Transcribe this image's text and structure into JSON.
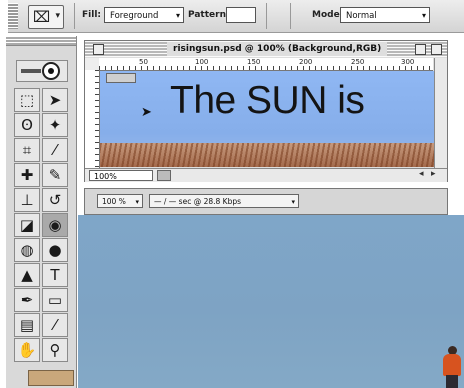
{
  "options_bar": {
    "tool_preset_glyph": "⌧",
    "fill_label": "Fill:",
    "fill_value": "Foreground",
    "pattern_label": "Pattern:",
    "mode_label": "Mode:",
    "mode_value": "Normal"
  },
  "toolbox": {
    "tools": [
      {
        "name": "marquee-tool-icon",
        "glyph": "⬚"
      },
      {
        "name": "move-tool-icon",
        "glyph": "➤"
      },
      {
        "name": "lasso-tool-icon",
        "glyph": "ʘ"
      },
      {
        "name": "magic-wand-tool-icon",
        "glyph": "✦"
      },
      {
        "name": "crop-tool-icon",
        "glyph": "⌗"
      },
      {
        "name": "slice-tool-icon",
        "glyph": "⁄"
      },
      {
        "name": "healing-brush-tool-icon",
        "glyph": "✚"
      },
      {
        "name": "brush-tool-icon",
        "glyph": "✎"
      },
      {
        "name": "clone-stamp-tool-icon",
        "glyph": "⊥"
      },
      {
        "name": "history-brush-tool-icon",
        "glyph": "↺"
      },
      {
        "name": "eraser-tool-icon",
        "glyph": "◪"
      },
      {
        "name": "paint-bucket-tool-icon",
        "glyph": "◉"
      },
      {
        "name": "blur-tool-icon",
        "glyph": "◍"
      },
      {
        "name": "dodge-tool-icon",
        "glyph": "●"
      },
      {
        "name": "path-selection-tool-icon",
        "glyph": "▲"
      },
      {
        "name": "type-tool-icon",
        "glyph": "T"
      },
      {
        "name": "pen-tool-icon",
        "glyph": "✒"
      },
      {
        "name": "rectangle-tool-icon",
        "glyph": "▭"
      },
      {
        "name": "notes-tool-icon",
        "glyph": "▤"
      },
      {
        "name": "eyedropper-tool-icon",
        "glyph": "⁄"
      },
      {
        "name": "hand-tool-icon",
        "glyph": "✋"
      },
      {
        "name": "zoom-tool-icon",
        "glyph": "⚲"
      }
    ]
  },
  "document": {
    "title": "risingsun.psd @ 100% (Background,RGB)",
    "ruler_labels": [
      "50",
      "100",
      "150",
      "200",
      "250",
      "300"
    ],
    "canvas_text": "The SUN is",
    "zoom": "100%"
  },
  "panel": {
    "resolution": "100 %",
    "rate": "— / — sec @ 28.8 Kbps"
  },
  "colors": {
    "sky": "#8fb7f3",
    "grass": "#b27a5a",
    "background_photo": "#7fa6c8"
  }
}
